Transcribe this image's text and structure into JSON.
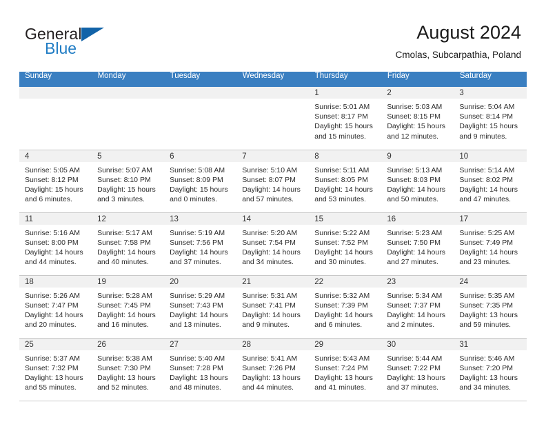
{
  "brand": {
    "word1": "General",
    "word2": "Blue",
    "logo_icon": "triangle-logo-icon"
  },
  "header": {
    "title": "August 2024",
    "location": "Cmolas, Subcarpathia, Poland"
  },
  "colors": {
    "header_blue": "#3a7fc1",
    "brand_blue": "#1f7cc4",
    "daynum_bg": "#f1f1f1",
    "grid_line": "#c8c8c8"
  },
  "weekdays": [
    "Sunday",
    "Monday",
    "Tuesday",
    "Wednesday",
    "Thursday",
    "Friday",
    "Saturday"
  ],
  "weeks": [
    [
      {
        "day": "",
        "empty": true,
        "lines": []
      },
      {
        "day": "",
        "empty": true,
        "lines": []
      },
      {
        "day": "",
        "empty": true,
        "lines": []
      },
      {
        "day": "",
        "empty": true,
        "lines": []
      },
      {
        "day": "1",
        "empty": false,
        "lines": [
          "Sunrise: 5:01 AM",
          "Sunset: 8:17 PM",
          "Daylight: 15 hours",
          "and 15 minutes."
        ]
      },
      {
        "day": "2",
        "empty": false,
        "lines": [
          "Sunrise: 5:03 AM",
          "Sunset: 8:15 PM",
          "Daylight: 15 hours",
          "and 12 minutes."
        ]
      },
      {
        "day": "3",
        "empty": false,
        "lines": [
          "Sunrise: 5:04 AM",
          "Sunset: 8:14 PM",
          "Daylight: 15 hours",
          "and 9 minutes."
        ]
      }
    ],
    [
      {
        "day": "4",
        "empty": false,
        "lines": [
          "Sunrise: 5:05 AM",
          "Sunset: 8:12 PM",
          "Daylight: 15 hours",
          "and 6 minutes."
        ]
      },
      {
        "day": "5",
        "empty": false,
        "lines": [
          "Sunrise: 5:07 AM",
          "Sunset: 8:10 PM",
          "Daylight: 15 hours",
          "and 3 minutes."
        ]
      },
      {
        "day": "6",
        "empty": false,
        "lines": [
          "Sunrise: 5:08 AM",
          "Sunset: 8:09 PM",
          "Daylight: 15 hours",
          "and 0 minutes."
        ]
      },
      {
        "day": "7",
        "empty": false,
        "lines": [
          "Sunrise: 5:10 AM",
          "Sunset: 8:07 PM",
          "Daylight: 14 hours",
          "and 57 minutes."
        ]
      },
      {
        "day": "8",
        "empty": false,
        "lines": [
          "Sunrise: 5:11 AM",
          "Sunset: 8:05 PM",
          "Daylight: 14 hours",
          "and 53 minutes."
        ]
      },
      {
        "day": "9",
        "empty": false,
        "lines": [
          "Sunrise: 5:13 AM",
          "Sunset: 8:03 PM",
          "Daylight: 14 hours",
          "and 50 minutes."
        ]
      },
      {
        "day": "10",
        "empty": false,
        "lines": [
          "Sunrise: 5:14 AM",
          "Sunset: 8:02 PM",
          "Daylight: 14 hours",
          "and 47 minutes."
        ]
      }
    ],
    [
      {
        "day": "11",
        "empty": false,
        "lines": [
          "Sunrise: 5:16 AM",
          "Sunset: 8:00 PM",
          "Daylight: 14 hours",
          "and 44 minutes."
        ]
      },
      {
        "day": "12",
        "empty": false,
        "lines": [
          "Sunrise: 5:17 AM",
          "Sunset: 7:58 PM",
          "Daylight: 14 hours",
          "and 40 minutes."
        ]
      },
      {
        "day": "13",
        "empty": false,
        "lines": [
          "Sunrise: 5:19 AM",
          "Sunset: 7:56 PM",
          "Daylight: 14 hours",
          "and 37 minutes."
        ]
      },
      {
        "day": "14",
        "empty": false,
        "lines": [
          "Sunrise: 5:20 AM",
          "Sunset: 7:54 PM",
          "Daylight: 14 hours",
          "and 34 minutes."
        ]
      },
      {
        "day": "15",
        "empty": false,
        "lines": [
          "Sunrise: 5:22 AM",
          "Sunset: 7:52 PM",
          "Daylight: 14 hours",
          "and 30 minutes."
        ]
      },
      {
        "day": "16",
        "empty": false,
        "lines": [
          "Sunrise: 5:23 AM",
          "Sunset: 7:50 PM",
          "Daylight: 14 hours",
          "and 27 minutes."
        ]
      },
      {
        "day": "17",
        "empty": false,
        "lines": [
          "Sunrise: 5:25 AM",
          "Sunset: 7:49 PM",
          "Daylight: 14 hours",
          "and 23 minutes."
        ]
      }
    ],
    [
      {
        "day": "18",
        "empty": false,
        "lines": [
          "Sunrise: 5:26 AM",
          "Sunset: 7:47 PM",
          "Daylight: 14 hours",
          "and 20 minutes."
        ]
      },
      {
        "day": "19",
        "empty": false,
        "lines": [
          "Sunrise: 5:28 AM",
          "Sunset: 7:45 PM",
          "Daylight: 14 hours",
          "and 16 minutes."
        ]
      },
      {
        "day": "20",
        "empty": false,
        "lines": [
          "Sunrise: 5:29 AM",
          "Sunset: 7:43 PM",
          "Daylight: 14 hours",
          "and 13 minutes."
        ]
      },
      {
        "day": "21",
        "empty": false,
        "lines": [
          "Sunrise: 5:31 AM",
          "Sunset: 7:41 PM",
          "Daylight: 14 hours",
          "and 9 minutes."
        ]
      },
      {
        "day": "22",
        "empty": false,
        "lines": [
          "Sunrise: 5:32 AM",
          "Sunset: 7:39 PM",
          "Daylight: 14 hours",
          "and 6 minutes."
        ]
      },
      {
        "day": "23",
        "empty": false,
        "lines": [
          "Sunrise: 5:34 AM",
          "Sunset: 7:37 PM",
          "Daylight: 14 hours",
          "and 2 minutes."
        ]
      },
      {
        "day": "24",
        "empty": false,
        "lines": [
          "Sunrise: 5:35 AM",
          "Sunset: 7:35 PM",
          "Daylight: 13 hours",
          "and 59 minutes."
        ]
      }
    ],
    [
      {
        "day": "25",
        "empty": false,
        "lines": [
          "Sunrise: 5:37 AM",
          "Sunset: 7:32 PM",
          "Daylight: 13 hours",
          "and 55 minutes."
        ]
      },
      {
        "day": "26",
        "empty": false,
        "lines": [
          "Sunrise: 5:38 AM",
          "Sunset: 7:30 PM",
          "Daylight: 13 hours",
          "and 52 minutes."
        ]
      },
      {
        "day": "27",
        "empty": false,
        "lines": [
          "Sunrise: 5:40 AM",
          "Sunset: 7:28 PM",
          "Daylight: 13 hours",
          "and 48 minutes."
        ]
      },
      {
        "day": "28",
        "empty": false,
        "lines": [
          "Sunrise: 5:41 AM",
          "Sunset: 7:26 PM",
          "Daylight: 13 hours",
          "and 44 minutes."
        ]
      },
      {
        "day": "29",
        "empty": false,
        "lines": [
          "Sunrise: 5:43 AM",
          "Sunset: 7:24 PM",
          "Daylight: 13 hours",
          "and 41 minutes."
        ]
      },
      {
        "day": "30",
        "empty": false,
        "lines": [
          "Sunrise: 5:44 AM",
          "Sunset: 7:22 PM",
          "Daylight: 13 hours",
          "and 37 minutes."
        ]
      },
      {
        "day": "31",
        "empty": false,
        "lines": [
          "Sunrise: 5:46 AM",
          "Sunset: 7:20 PM",
          "Daylight: 13 hours",
          "and 34 minutes."
        ]
      }
    ]
  ]
}
